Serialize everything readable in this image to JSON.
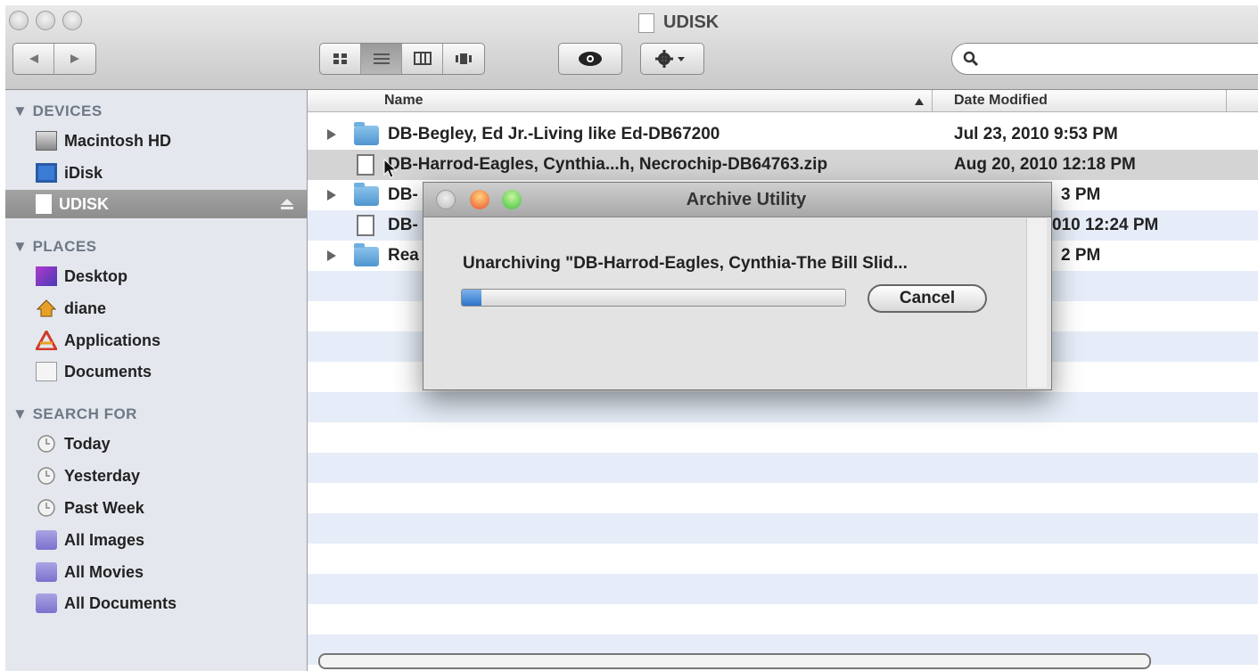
{
  "window": {
    "title": "UDISK"
  },
  "toolbar": {
    "view_modes": [
      "icon-view",
      "list-view",
      "column-view",
      "coverflow-view"
    ],
    "active_view": 1,
    "search_placeholder": ""
  },
  "sidebar": {
    "sections": [
      {
        "label": "DEVICES",
        "items": [
          {
            "label": "Macintosh HD",
            "icon": "hard-drive-icon"
          },
          {
            "label": "iDisk",
            "icon": "idisk-icon"
          },
          {
            "label": "UDISK",
            "icon": "disk-icon",
            "selected": true
          }
        ]
      },
      {
        "label": "PLACES",
        "items": [
          {
            "label": "Desktop",
            "icon": "desktop-icon"
          },
          {
            "label": "diane",
            "icon": "home-icon"
          },
          {
            "label": "Applications",
            "icon": "applications-icon"
          },
          {
            "label": "Documents",
            "icon": "documents-icon"
          }
        ]
      },
      {
        "label": "SEARCH FOR",
        "items": [
          {
            "label": "Today",
            "icon": "clock-icon"
          },
          {
            "label": "Yesterday",
            "icon": "clock-icon"
          },
          {
            "label": "Past Week",
            "icon": "clock-icon"
          },
          {
            "label": "All Images",
            "icon": "smart-folder-icon"
          },
          {
            "label": "All Movies",
            "icon": "smart-folder-icon"
          },
          {
            "label": "All Documents",
            "icon": "smart-folder-icon"
          }
        ]
      }
    ]
  },
  "list": {
    "columns": {
      "name": "Name",
      "date": "Date Modified"
    },
    "rows": [
      {
        "name": "DB-Begley, Ed Jr.-Living like Ed-DB67200",
        "date": "Jul 23, 2010 9:53 PM",
        "type": "folder"
      },
      {
        "name": "DB-Harrod-Eagles, Cynthia...h, Necrochip-DB64763.zip",
        "date": "Aug 20, 2010 12:18 PM",
        "type": "file",
        "selected": true
      },
      {
        "name": "DB-",
        "date": "3 PM",
        "type": "folder"
      },
      {
        "name": "DB-",
        "date": "010 12:24 PM",
        "type": "file"
      },
      {
        "name": "Rea",
        "date": "2 PM",
        "type": "folder"
      }
    ]
  },
  "dialog": {
    "title": "Archive Utility",
    "message": "Unarchiving \"DB-Harrod-Eagles, Cynthia-The Bill Slid...",
    "progress": 0.05,
    "cancel_label": "Cancel"
  },
  "colors": {
    "stripe": "#e6edf8",
    "selection": "#d4d4d4",
    "progress": "#2e73c9",
    "close": "#e9502f",
    "minimize": "#f0b429",
    "zoom": "#3cbf3a"
  }
}
